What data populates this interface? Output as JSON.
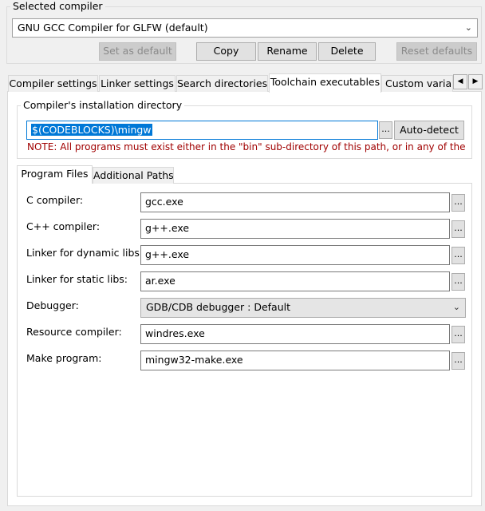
{
  "selected_compiler": {
    "legend": "Selected compiler",
    "value": "GNU GCC Compiler for GLFW (default)",
    "buttons": {
      "set_default": "Set as default",
      "copy": "Copy",
      "rename": "Rename",
      "delete": "Delete",
      "reset": "Reset defaults"
    }
  },
  "tabs": [
    {
      "label": "Compiler settings"
    },
    {
      "label": "Linker settings"
    },
    {
      "label": "Search directories"
    },
    {
      "label": "Toolchain executables",
      "active": true
    },
    {
      "label": "Custom variab"
    }
  ],
  "install_dir": {
    "legend": "Compiler's installation directory",
    "value": "$(CODEBLOCKS)\\mingw",
    "browse": "...",
    "autodetect": "Auto-detect",
    "note": "NOTE: All programs must exist either in the \"bin\" sub-directory of this path, or in any of the"
  },
  "subtabs": [
    {
      "label": "Program Files",
      "active": true
    },
    {
      "label": "Additional Paths"
    }
  ],
  "programs": {
    "c_compiler": {
      "label": "C compiler:",
      "value": "gcc.exe"
    },
    "cpp_compiler": {
      "label": "C++ compiler:",
      "value": "g++.exe"
    },
    "linker_dynamic": {
      "label": "Linker for dynamic libs:",
      "value": "g++.exe"
    },
    "linker_static": {
      "label": "Linker for static libs:",
      "value": "ar.exe"
    },
    "debugger": {
      "label": "Debugger:",
      "value": "GDB/CDB debugger : Default"
    },
    "resource_compiler": {
      "label": "Resource compiler:",
      "value": "windres.exe"
    },
    "make_program": {
      "label": "Make program:",
      "value": "mingw32-make.exe"
    }
  },
  "browse_label": "..."
}
